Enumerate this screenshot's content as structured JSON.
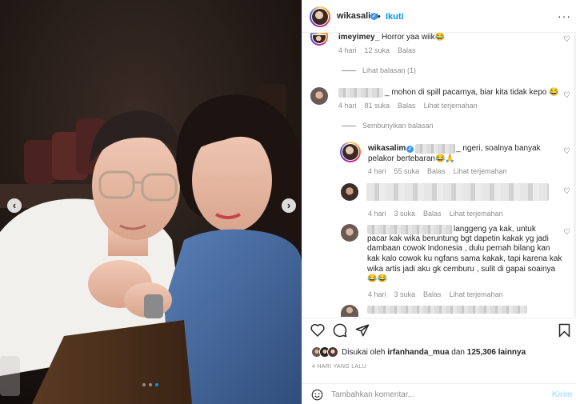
{
  "post": {
    "username": "wikasalim",
    "follow_label": "Ikuti",
    "separator": "•",
    "more_label": "···"
  },
  "comments": [
    {
      "username": "imeyimey_",
      "text": "Horror yaa wiik😂",
      "time": "4 hari",
      "likes": "12 suka",
      "reply": "Balas",
      "view_replies": "Lihat balasan (1)"
    },
    {
      "text": "_ mohon di spill pacarnya, biar kita tidak kepo 😂",
      "time": "4 hari",
      "likes": "81 suka",
      "reply": "Balas",
      "translate": "Lihat terjemahan",
      "hide_replies": "Sembunyikan balasan"
    }
  ],
  "replies": [
    {
      "username": "wikasalim",
      "text_line1": "_ ngeri, soalnya banyak",
      "text_line2": "pelakor bertebaran😂🙏",
      "time": "4 hari",
      "likes": "55 suka",
      "reply": "Balas",
      "translate": "Lihat terjemahan"
    },
    {
      "time": "4 hari",
      "likes": "3 suka",
      "reply": "Balas",
      "translate": "Lihat terjemahan"
    },
    {
      "lines": [
        "langgeng ya kak, untuk",
        "pacar kak wika beruntung bgt dapetin kakak yg jadi",
        "dambaan cowok Indonesia , dulu pernah bilang kan",
        "kak kalo cowok ku ngfans sama kakak, tapi karena kak",
        "wika artis jadi aku gk cemburu , sulit di gapai soainya",
        "😂😂"
      ],
      "time": "4 hari",
      "likes": "3 suka",
      "reply": "Balas",
      "translate": "Lihat terjemahan"
    }
  ],
  "likes_bar": {
    "prefix": "Disukai oleh",
    "user": "irfanhanda_mua",
    "joiner": "dan",
    "count": "125,306",
    "suffix": "lainnya"
  },
  "timestamp": "4 HARI YANG LALU",
  "composer": {
    "placeholder": "Tambahkan komentar...",
    "post_label": "Kirim"
  },
  "icons": {
    "header": [
      "verified-badge-icon",
      "more-options-icon"
    ],
    "actions": [
      "heart-icon",
      "comment-icon",
      "share-icon",
      "bookmark-icon"
    ],
    "composer": [
      "emoji-icon"
    ],
    "carousel": [
      "chevron-left-icon",
      "chevron-right-icon"
    ]
  },
  "colors": {
    "accent": "#0095f6",
    "verified": "#3897f0",
    "muted": "#8e8e8e"
  }
}
